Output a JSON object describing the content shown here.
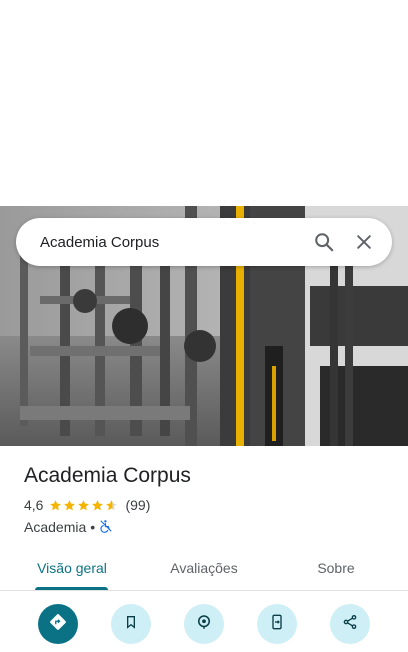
{
  "search": {
    "query": "Academia Corpus"
  },
  "place": {
    "name": "Academia Corpus",
    "rating": "4,6",
    "stars": 4.6,
    "review_count": "(99)",
    "category": "Academia",
    "separator": "•"
  },
  "tabs": [
    {
      "label": "Visão geral",
      "active": true
    },
    {
      "label": "Avaliações",
      "active": false
    },
    {
      "label": "Sobre",
      "active": false
    }
  ],
  "actions": [
    {
      "icon": "directions-icon"
    },
    {
      "icon": "bookmark-icon"
    },
    {
      "icon": "location-pin-icon"
    },
    {
      "icon": "send-to-phone-icon"
    },
    {
      "icon": "share-icon"
    }
  ],
  "colors": {
    "accent": "#0b7285",
    "action_bg": "#cdeff5",
    "star": "#f4b400"
  }
}
